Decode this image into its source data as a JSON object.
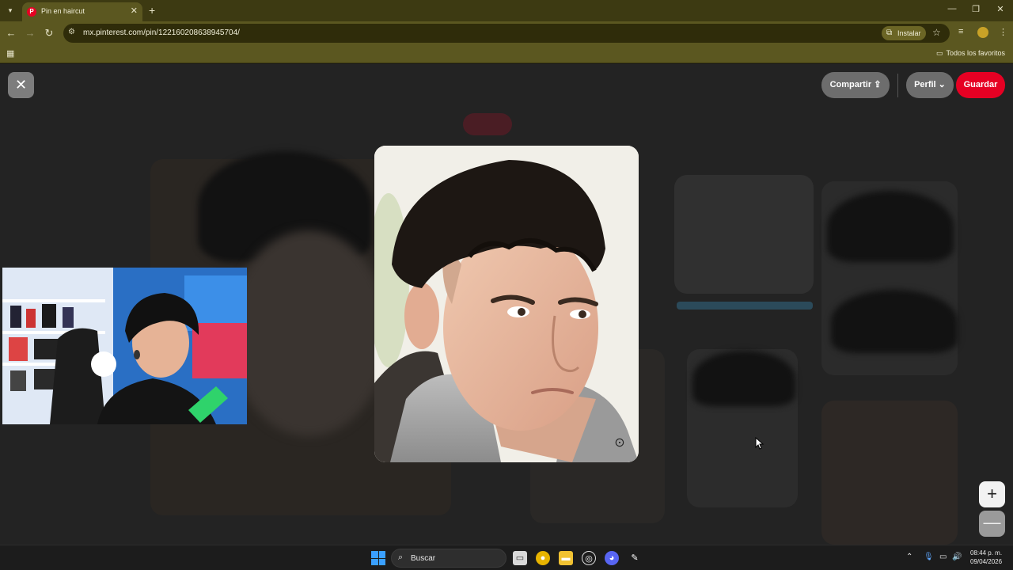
{
  "browser": {
    "tab_title": "Pin en haircut",
    "url": "mx.pinterest.com/pin/122160208638945704/",
    "install_label": "Instalar",
    "all_bookmarks_label": "Todos los favoritos"
  },
  "pin_viewer": {
    "share_label": "Compartir",
    "profile_label": "Perfil",
    "save_label": "Guardar",
    "zoom_in_label": "+",
    "zoom_out_label": "—"
  },
  "taskbar": {
    "search_label": "Buscar",
    "time": "08:44 p. m.",
    "date": "09/04/2026"
  },
  "colors": {
    "brand_red": "#e60023",
    "chrome_olive": "#5b5720"
  }
}
